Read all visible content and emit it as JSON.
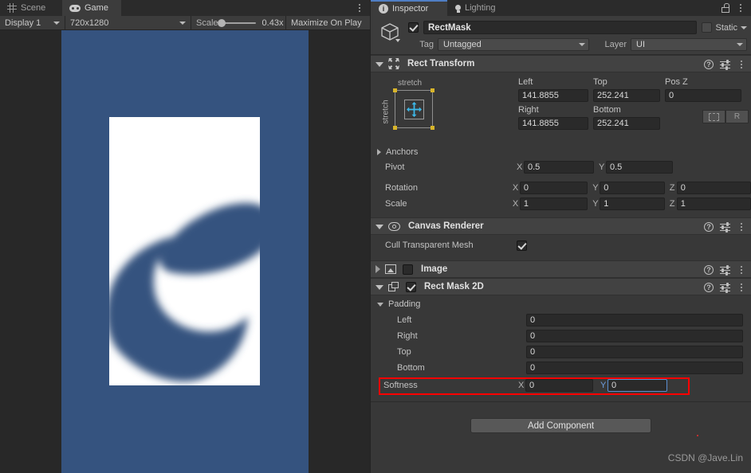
{
  "game_panel": {
    "tabs": [
      {
        "label": "Scene",
        "icon": "grid-icon",
        "active": false
      },
      {
        "label": "Game",
        "icon": "gamepad-icon",
        "active": true
      }
    ],
    "toolbar": {
      "display": "Display 1",
      "resolution": "720x1280",
      "scale_label": "Scale",
      "scale_value": "0.43x",
      "maximize": "Maximize On Play"
    },
    "canvas": {
      "background_color": "#35537f",
      "mask_rect_color": "#ffffff",
      "shape_color": "#35537f"
    }
  },
  "inspector": {
    "tabs": [
      {
        "label": "Inspector",
        "icon": "info-icon",
        "active": true
      },
      {
        "label": "Lighting",
        "icon": "bulb-icon",
        "active": false
      }
    ],
    "object": {
      "enabled": true,
      "name": "RectMask",
      "static_label": "Static",
      "static_checked": false,
      "tag_label": "Tag",
      "tag_value": "Untagged",
      "layer_label": "Layer",
      "layer_value": "UI"
    },
    "components": [
      {
        "title": "Rect Transform",
        "expanded": true,
        "icon": "rect-transform-icon"
      },
      {
        "title": "Canvas Renderer",
        "expanded": true,
        "icon": "eye-icon"
      },
      {
        "title": "Image",
        "expanded": false,
        "enabled": false,
        "icon": "image-icon"
      },
      {
        "title": "Rect Mask 2D",
        "expanded": true,
        "enabled": true,
        "icon": "mask-icon"
      }
    ],
    "rect_transform": {
      "anchor_preset_top": "stretch",
      "anchor_preset_left": "stretch",
      "headers": {
        "left": "Left",
        "top": "Top",
        "posz": "Pos Z",
        "right": "Right",
        "bottom": "Bottom"
      },
      "values": {
        "left": "141.8855",
        "top": "252.241",
        "posz": "0",
        "right": "141.8855",
        "bottom": "252.241"
      },
      "anchors_label": "Anchors",
      "pivot_label": "Pivot",
      "pivot": {
        "x": "0.5",
        "y": "0.5"
      },
      "rotation_label": "Rotation",
      "rotation": {
        "x": "0",
        "y": "0",
        "z": "0"
      },
      "scale_label": "Scale",
      "scale": {
        "x": "1",
        "y": "1",
        "z": "1"
      },
      "blueprint_button": "blueprint-mode",
      "raw_button": "R"
    },
    "canvas_renderer": {
      "cull_label": "Cull Transparent Mesh",
      "cull_checked": true
    },
    "rect_mask_2d": {
      "padding_label": "Padding",
      "padding": [
        {
          "label": "Left",
          "value": "0"
        },
        {
          "label": "Right",
          "value": "0"
        },
        {
          "label": "Top",
          "value": "0"
        },
        {
          "label": "Bottom",
          "value": "0"
        }
      ],
      "softness_label": "Softness",
      "softness": {
        "x": "0",
        "y": "0"
      },
      "softness_highlight_color": "#ff0000",
      "softness_y_focused": true
    },
    "add_component_label": "Add Component",
    "watermark": "CSDN @Jave.Lin"
  }
}
